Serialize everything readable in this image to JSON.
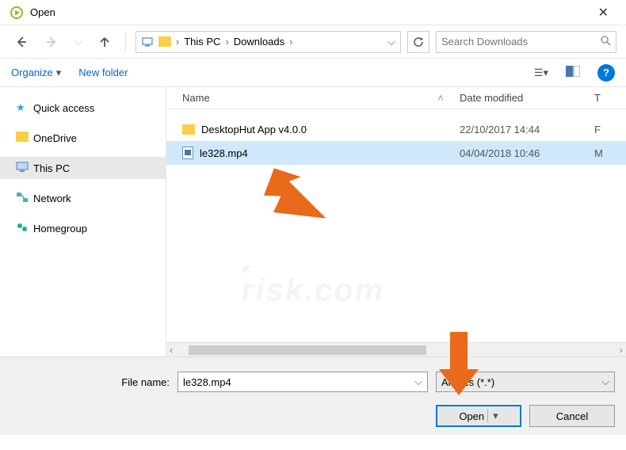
{
  "window": {
    "title": "Open"
  },
  "breadcrumb": {
    "items": [
      "This PC",
      "Downloads"
    ]
  },
  "search": {
    "placeholder": "Search Downloads"
  },
  "toolbar": {
    "organize": "Organize",
    "newfolder": "New folder"
  },
  "sidebar": {
    "items": [
      {
        "label": "Quick access"
      },
      {
        "label": "OneDrive"
      },
      {
        "label": "This PC"
      },
      {
        "label": "Network"
      },
      {
        "label": "Homegroup"
      }
    ]
  },
  "columns": {
    "name": "Name",
    "date": "Date modified",
    "type": "T"
  },
  "files": [
    {
      "name": "DesktopHut App v4.0.0",
      "date": "22/10/2017 14:44",
      "type": "F",
      "kind": "folder"
    },
    {
      "name": "le328.mp4",
      "date": "04/04/2018 10:46",
      "type": "M",
      "kind": "mp4",
      "selected": true
    }
  ],
  "bottom": {
    "filename_label": "File name:",
    "filename_value": "le328.mp4",
    "filter": "All files (*.*)",
    "open": "Open",
    "cancel": "Cancel"
  },
  "watermark": {
    "top": "PC",
    "sub": "risk.com"
  }
}
